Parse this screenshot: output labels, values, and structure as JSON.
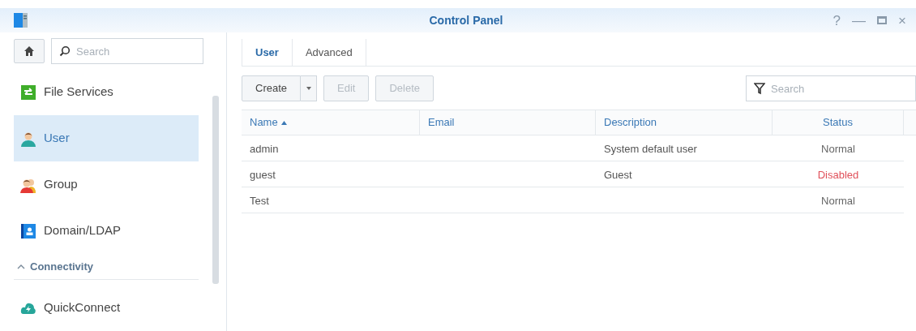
{
  "window": {
    "title": "Control Panel",
    "controls": [
      "?",
      "—",
      "×"
    ]
  },
  "sidebar": {
    "search_placeholder": "Search",
    "items": [
      {
        "kind": "item",
        "label": "File Services",
        "selected": false
      },
      {
        "kind": "item",
        "label": "User",
        "selected": true
      },
      {
        "kind": "item",
        "label": "Group",
        "selected": false
      },
      {
        "kind": "item",
        "label": "Domain/LDAP",
        "selected": false
      },
      {
        "kind": "section",
        "label": "Connectivity",
        "expanded": true
      },
      {
        "kind": "item",
        "label": "QuickConnect",
        "selected": false
      }
    ]
  },
  "tabs": [
    {
      "label": "User",
      "selected": true
    },
    {
      "label": "Advanced",
      "selected": false
    }
  ],
  "toolbar": {
    "buttons": [
      {
        "label": "Create",
        "disabled": false,
        "dropdown": true
      },
      {
        "label": "Edit",
        "disabled": true,
        "dropdown": false
      },
      {
        "label": "Delete",
        "disabled": true,
        "dropdown": false
      }
    ],
    "filter_placeholder": "Search"
  },
  "table": {
    "columns": [
      {
        "label": "Name",
        "sorted": true
      },
      {
        "label": "Email",
        "sorted": false
      },
      {
        "label": "Description",
        "sorted": false
      },
      {
        "label": "Status",
        "sorted": false
      }
    ],
    "rows": [
      {
        "name": "admin",
        "description": "System default user",
        "status": "Normal",
        "disabled": false
      },
      {
        "name": "guest",
        "description": "Guest",
        "status": "Disabled",
        "disabled": true
      },
      {
        "name": "Test",
        "status": "Normal",
        "disabled": false
      }
    ]
  }
}
